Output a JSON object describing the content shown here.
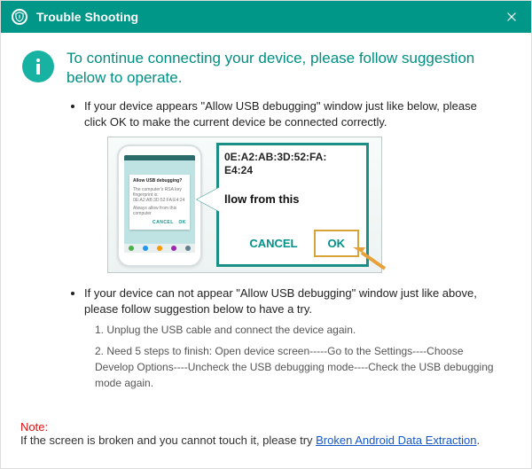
{
  "titlebar": {
    "title": "Trouble Shooting"
  },
  "heading": "To continue connecting your device, please follow suggestion below to operate.",
  "bullet1": "If your device appears \"Allow USB debugging\" window just like below, please click OK to make the current device  be connected correctly.",
  "bullet2": "If your device can not appear \"Allow USB debugging\" window just like above, please follow suggestion below to have a try.",
  "illustration": {
    "phone_dialog_title": "Allow USB debugging?",
    "phone_dialog_body1": "The computer's RSA key",
    "phone_dialog_body2": "fingerprint is:",
    "phone_dialog_body3": "0E:A2:AB:3D:52:FA:E4:24",
    "phone_dialog_check": "Always allow from this computer",
    "phone_dialog_cancel": "CANCEL",
    "phone_dialog_ok": "OK",
    "zoom_mac_line1": "0E:A2:AB:3D:52:FA:",
    "zoom_mac_line2": "E4:24",
    "zoom_allow": "llow from this",
    "zoom_cancel": "CANCEL",
    "zoom_ok": "OK"
  },
  "substeps": {
    "s1": "1. Unplug the USB cable and connect the device again.",
    "s2": "2. Need 5 steps to finish: Open device screen-----Go to the Settings----Choose Develop Options----Uncheck the USB debugging mode----Check the USB debugging mode again."
  },
  "note": {
    "label": "Note:",
    "text_before": "If the screen is broken and you cannot touch it, please try ",
    "link": "Broken Android Data Extraction",
    "text_after": "."
  }
}
